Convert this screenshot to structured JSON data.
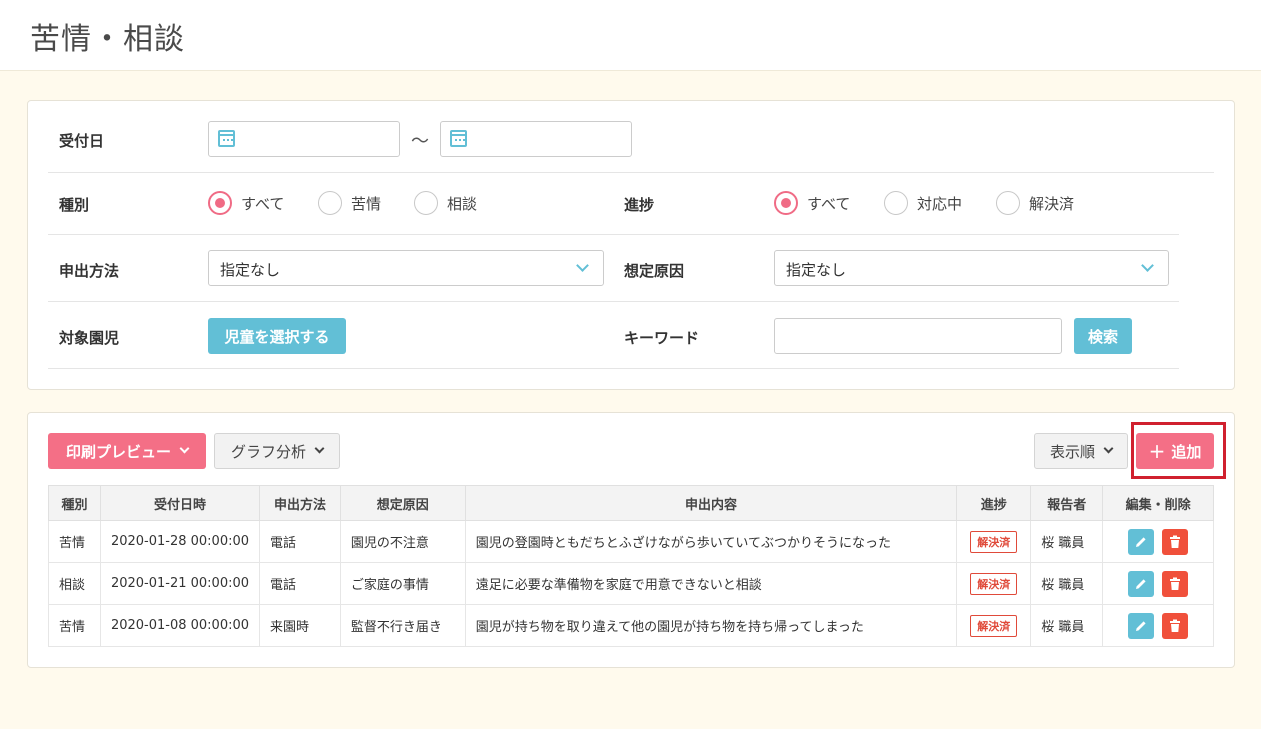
{
  "page": {
    "title": "苦情・相談"
  },
  "filters": {
    "date_label": "受付日",
    "date_separator": "〜",
    "type_label": "種別",
    "type_options": [
      "すべて",
      "苦情",
      "相談"
    ],
    "progress_label": "進捗",
    "progress_options": [
      "すべて",
      "対応中",
      "解決済"
    ],
    "method_label": "申出方法",
    "method_value": "指定なし",
    "cause_label": "想定原因",
    "cause_value": "指定なし",
    "child_label": "対象園児",
    "child_button": "児童を選択する",
    "keyword_label": "キーワード",
    "search_button": "検索"
  },
  "toolbar": {
    "print_preview": "印刷プレビュー",
    "graph_analysis": "グラフ分析",
    "sort_order": "表示順",
    "add": "追加"
  },
  "table": {
    "headers": [
      "種別",
      "受付日時",
      "申出方法",
      "想定原因",
      "申出内容",
      "進捗",
      "報告者",
      "編集・削除"
    ],
    "rows": [
      {
        "type": "苦情",
        "datetime": "2020-01-28 00:00:00",
        "method": "電話",
        "cause": "園児の不注意",
        "content": "園児の登園時ともだちとふざけながら歩いていてぶつかりそうになった",
        "status": "解決済",
        "reporter": "桜 職員"
      },
      {
        "type": "相談",
        "datetime": "2020-01-21 00:00:00",
        "method": "電話",
        "cause": "ご家庭の事情",
        "content": "遠足に必要な準備物を家庭で用意できないと相談",
        "status": "解決済",
        "reporter": "桜 職員"
      },
      {
        "type": "苦情",
        "datetime": "2020-01-08 00:00:00",
        "method": "来園時",
        "cause": "監督不行き届き",
        "content": "園児が持ち物を取り違えて他の園児が持ち物を持ち帰ってしまった",
        "status": "解決済",
        "reporter": "桜 職員"
      }
    ]
  },
  "icons": {
    "calendar": "calendar-icon",
    "edit": "pencil-icon",
    "delete": "trash-icon",
    "add": "plus-icon"
  },
  "colors": {
    "accent_blue": "#62bfd6",
    "accent_pink": "#f46f86",
    "danger": "#f0503b",
    "highlight": "#d0202e"
  }
}
